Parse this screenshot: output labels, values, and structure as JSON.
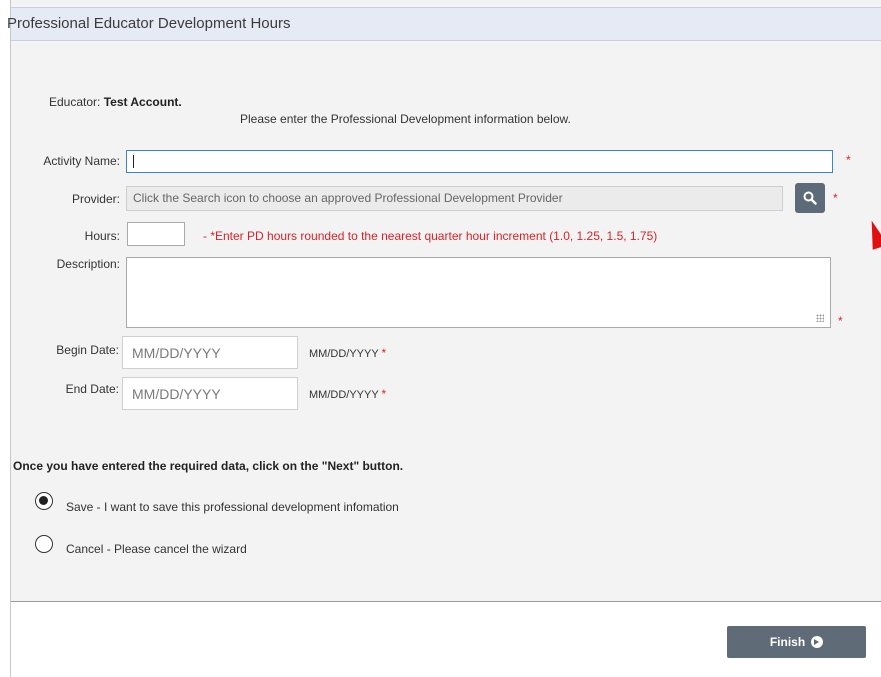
{
  "header": {
    "title": "Professional Educator Development Hours"
  },
  "educator": {
    "label": "Educator:",
    "name": "Test Account."
  },
  "instructions": "Please enter the Professional Development information below.",
  "form": {
    "activity_name": {
      "label": "Activity Name:",
      "value": "",
      "required_mark": "*"
    },
    "provider": {
      "label": "Provider:",
      "placeholder": "Click the Search icon to choose an approved Professional Development Provider",
      "required_mark": "*",
      "search_icon": "search-icon"
    },
    "hours": {
      "label": "Hours:",
      "value": "",
      "hint": "- *Enter PD hours rounded to the nearest quarter hour increment (1.0, 1.25, 1.5, 1.75)"
    },
    "description": {
      "label": "Description:",
      "value": "",
      "required_mark": "*"
    },
    "begin_date": {
      "label": "Begin Date:",
      "placeholder": "MM/DD/YYYY",
      "format": "MM/DD/YYYY",
      "required_mark": "*"
    },
    "end_date": {
      "label": "End Date:",
      "placeholder": "MM/DD/YYYY",
      "format": "MM/DD/YYYY",
      "required_mark": "*"
    }
  },
  "next_instruction": "Once you have entered the required data, click on the \"Next\" button.",
  "options": [
    {
      "label": "Save - I want to save this professional development infomation",
      "selected": true
    },
    {
      "label": "Cancel - Please cancel the wizard",
      "selected": false
    }
  ],
  "footer": {
    "finish_label": "Finish"
  },
  "colors": {
    "accent_red": "#d6232a",
    "button_bg": "#5f6b77",
    "header_bg": "#e6eaf5"
  }
}
